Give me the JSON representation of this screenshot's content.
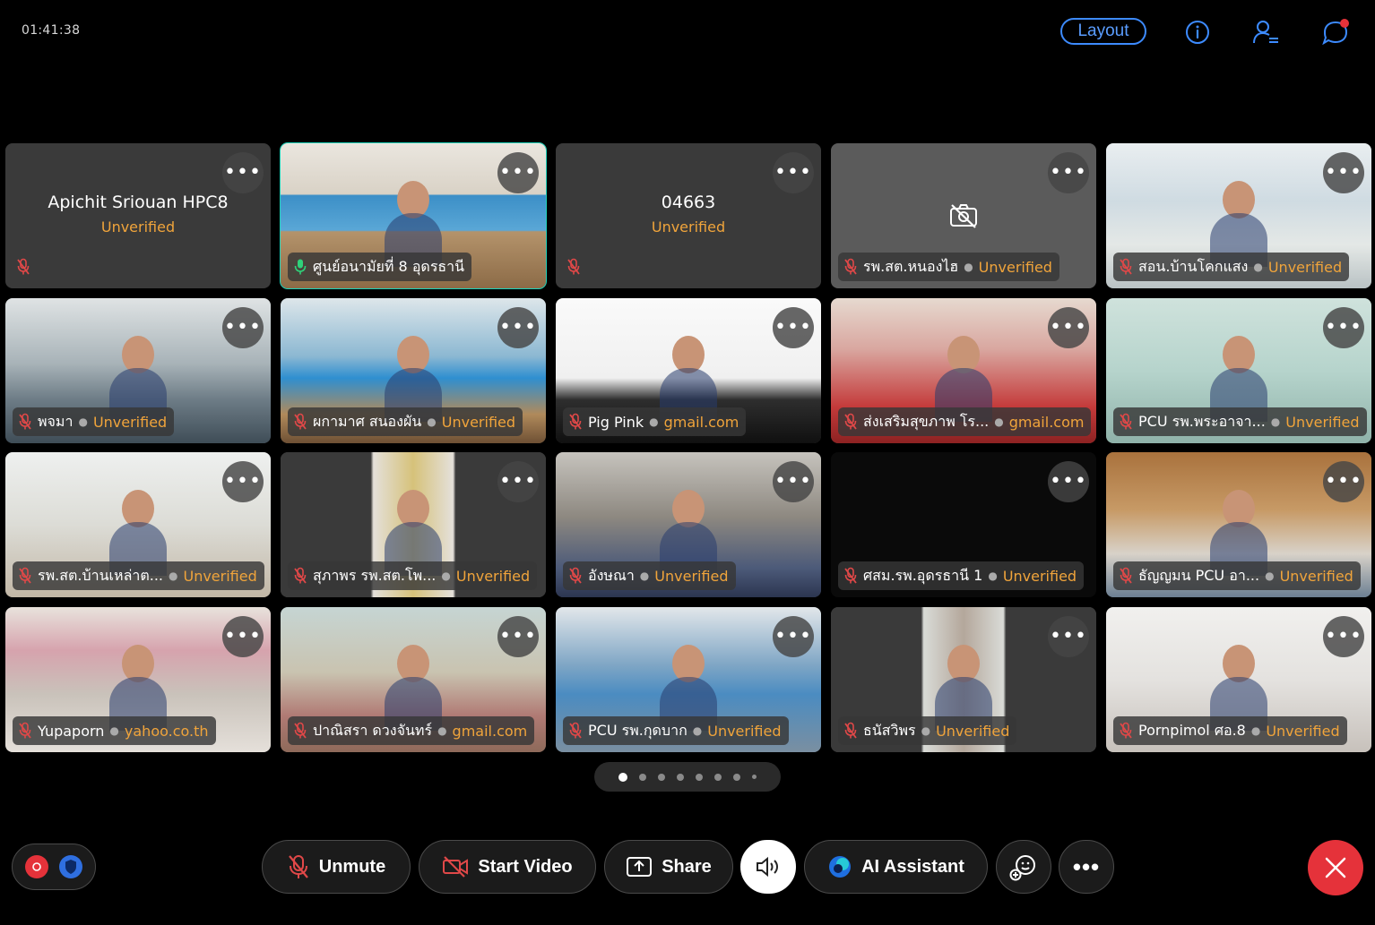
{
  "header": {
    "timer": "01:41:38",
    "layout_label": "Layout"
  },
  "tiles": [
    {
      "name": "Apichit Sriouan HPC8",
      "status": "Unverified",
      "mode": "noavatar"
    },
    {
      "name": "ศูนย์อนามัยที่ 8 อุดรธานี",
      "status": "",
      "mode": "video",
      "active": true,
      "mic_on": true
    },
    {
      "name": "04663",
      "status": "Unverified",
      "mode": "noavatar"
    },
    {
      "name": "รพ.สต.หนองไฮ",
      "status": "Unverified",
      "mode": "camoff"
    },
    {
      "name": "สอน.บ้านโคกแสง",
      "status": "Unverified",
      "mode": "video"
    },
    {
      "name": "พจมา",
      "status": "Unverified",
      "mode": "video"
    },
    {
      "name": "ผกามาศ สนองผัน",
      "status": "Unverified",
      "mode": "video"
    },
    {
      "name": "Pig Pink",
      "status": "gmail.com",
      "mode": "video"
    },
    {
      "name": "ส่งเสริมสุขภาพ โร...",
      "status": "gmail.com",
      "mode": "video"
    },
    {
      "name": "PCU รพ.พระอาจา...",
      "status": "Unverified",
      "mode": "video"
    },
    {
      "name": "รพ.สต.บ้านเหล่าต...",
      "status": "Unverified",
      "mode": "video"
    },
    {
      "name": "สุภาพร รพ.สต.โพ...",
      "status": "Unverified",
      "mode": "portrait"
    },
    {
      "name": "อังษณา",
      "status": "Unverified",
      "mode": "video"
    },
    {
      "name": "ศสม.รพ.อุดรธานี 1",
      "status": "Unverified",
      "mode": "dark"
    },
    {
      "name": "ธัญญมน PCU อา...",
      "status": "Unverified",
      "mode": "video"
    },
    {
      "name": "Yupaporn",
      "status": "yahoo.co.th",
      "mode": "video"
    },
    {
      "name": "ปาณิสรา ดวงจันทร์",
      "status": "gmail.com",
      "mode": "video"
    },
    {
      "name": "PCU รพ.กุดบาก",
      "status": "Unverified",
      "mode": "video"
    },
    {
      "name": "ธนัสวิพร",
      "status": "Unverified",
      "mode": "portrait"
    },
    {
      "name": "Pornpimol ศอ.8",
      "status": "Unverified",
      "mode": "video"
    }
  ],
  "pager": {
    "pages": 8,
    "current": 1
  },
  "controls": {
    "unmute_label": "Unmute",
    "start_video_label": "Start Video",
    "share_label": "Share",
    "ai_assistant_label": "AI Assistant"
  },
  "colors": {
    "unverified": "#f0a43b",
    "accent_blue": "#3d8bff",
    "active_border": "#19b6a1",
    "end_call": "#e5323a",
    "muted_mic": "#e04848"
  },
  "icons": [
    "info-icon",
    "participants-icon",
    "chat-icon",
    "mic-muted-icon",
    "more-icon",
    "camera-off-icon",
    "video-off-icon",
    "share-icon",
    "speaker-icon",
    "ai-assistant-icon",
    "reactions-icon",
    "close-icon",
    "record-icon",
    "shield-icon"
  ]
}
